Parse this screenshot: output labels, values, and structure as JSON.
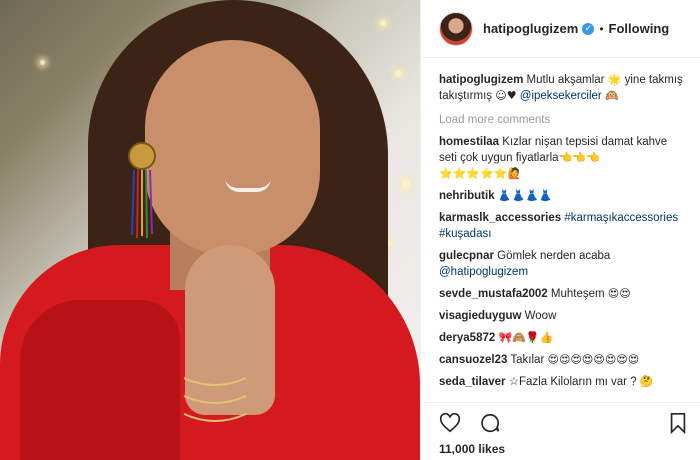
{
  "post": {
    "username": "hatipoglugizem",
    "follow_status": "Following",
    "likes": "11,000 likes"
  },
  "comments": {
    "caption": {
      "user": "hatipoglugizem",
      "text_1": "Mutlu akşamlar",
      "emoji_1": "🌟",
      "text_2": "yine takmış takıştırmış",
      "emoji_2": "☺♥",
      "mention": "@ipeksekerciler",
      "emoji_3": "🙉"
    },
    "load_more": "Load more comments",
    "items": [
      {
        "user": "homestilaa",
        "text": "Kızlar nişan tepsisi damat kahve seti çok uygun fiyatlarla",
        "emoji": "👈👈👈",
        "emoji_line": "⭐⭐⭐⭐⭐🙋"
      },
      {
        "user": "nehributik",
        "emoji": "👗👗👗👗"
      },
      {
        "user": "karmaslk_accessories",
        "tag_1": "#karmaşıkaccessories",
        "tag_2": "#kuşadası"
      },
      {
        "user": "gulecpnar",
        "text": "Gömlek nerden acaba",
        "mention": "@hatipoglugizem"
      },
      {
        "user": "sevde_mustafa2002",
        "text": "Muhteşem",
        "emoji": "😍😍"
      },
      {
        "user": "visagieduyguw",
        "text": "Woow"
      },
      {
        "user": "derya5872",
        "emoji": "🎀🙈🌹👍"
      },
      {
        "user": "cansuozel23",
        "text": "Takılar",
        "emoji": "😍😍😍😍😍😍😍😍"
      },
      {
        "user": "seda_tilaver",
        "text": "☆Fazla Kiloların mı var ?",
        "emoji": "🤔"
      }
    ]
  },
  "icons": {
    "verified": "verified-badge-icon",
    "like": "heart-icon",
    "comment": "comment-bubble-icon",
    "save": "bookmark-icon"
  },
  "colors": {
    "link": "#003569",
    "verified": "#3897f0",
    "muted": "#999999"
  }
}
